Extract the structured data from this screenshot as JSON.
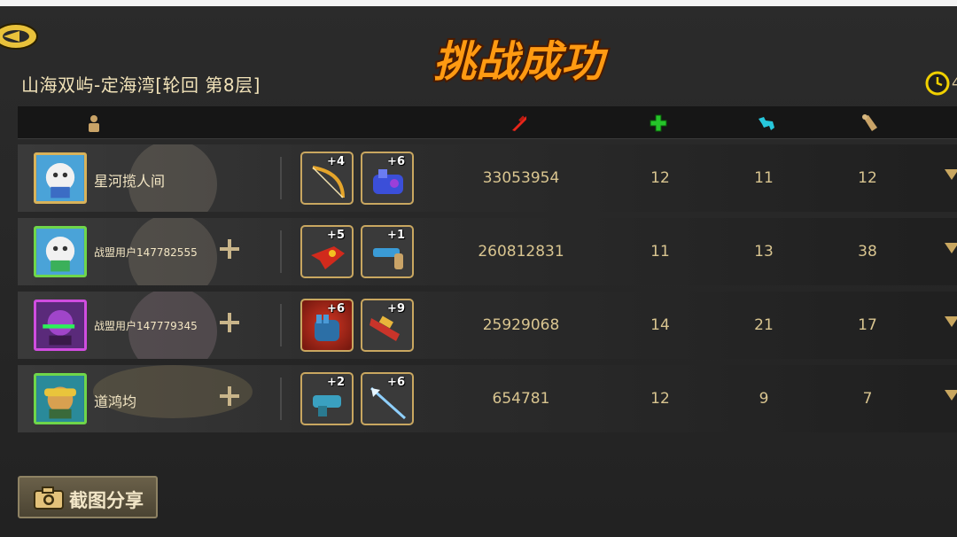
{
  "level_title": "山海双屿-定海湾[轮回  第8层]",
  "banner_text": "挑战成功",
  "timer_value": "4",
  "columns": [
    "player-icon",
    "damage-icon",
    "heal-icon",
    "wolf-icon",
    "scroll-icon"
  ],
  "rows": [
    {
      "name": "星河揽人间",
      "name_small": false,
      "has_plus": false,
      "avatar_frame": "gold",
      "items": [
        {
          "level": "+4",
          "icon": "bow",
          "bg": "normal"
        },
        {
          "level": "+6",
          "icon": "gauntlet",
          "bg": "normal"
        }
      ],
      "damage": "33053954",
      "heal": "12",
      "wolf": "11",
      "scroll": "12"
    },
    {
      "name": "战盟用户147782555",
      "name_small": true,
      "has_plus": true,
      "avatar_frame": "green",
      "items": [
        {
          "level": "+5",
          "icon": "claw",
          "bg": "normal"
        },
        {
          "level": "+1",
          "icon": "gun",
          "bg": "normal"
        }
      ],
      "damage": "260812831",
      "heal": "11",
      "wolf": "13",
      "scroll": "38"
    },
    {
      "name": "战盟用户147779345",
      "name_small": true,
      "has_plus": true,
      "avatar_frame": "purple",
      "items": [
        {
          "level": "+6",
          "icon": "glove",
          "bg": "red"
        },
        {
          "level": "+9",
          "icon": "cannon",
          "bg": "normal"
        }
      ],
      "damage": "25929068",
      "heal": "14",
      "wolf": "21",
      "scroll": "17"
    },
    {
      "name": "道鸿均",
      "name_small": false,
      "has_plus": true,
      "avatar_frame": "green",
      "items": [
        {
          "level": "+2",
          "icon": "blaster",
          "bg": "normal"
        },
        {
          "level": "+6",
          "icon": "spear",
          "bg": "normal"
        }
      ],
      "damage": "654781",
      "heal": "12",
      "wolf": "9",
      "scroll": "7"
    }
  ],
  "share_label": "截图分享",
  "colors": {
    "accent": "#e8d7a6",
    "banner": "#ff8a00",
    "heal": "#25c52a",
    "wolf": "#27c7dc",
    "damage": "#e8261a"
  }
}
